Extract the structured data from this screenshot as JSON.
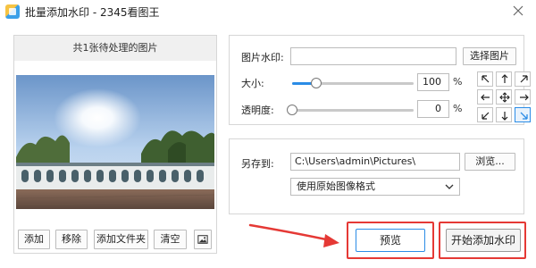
{
  "window": {
    "title": "批量添加水印 - 2345看图王"
  },
  "left_panel": {
    "header": "共1张待处理的图片",
    "buttons": {
      "add": "添加",
      "remove": "移除",
      "add_folder": "添加文件夹",
      "clear": "清空"
    }
  },
  "watermark": {
    "image_label": "图片水印:",
    "image_value": "",
    "choose_button": "选择图片",
    "size_label": "大小:",
    "size_value": "100",
    "size_unit": "%",
    "size_level": 0.2,
    "opacity_label": "透明度:",
    "opacity_value": "0",
    "opacity_unit": "%",
    "opacity_level": 0.0,
    "selected_position": "bottom-right"
  },
  "save": {
    "label": "另存到:",
    "path": "C:\\Users\\admin\\Pictures\\",
    "browse_button": "浏览...",
    "format": "使用原始图像格式"
  },
  "actions": {
    "preview": "预览",
    "start": "开始添加水印"
  },
  "colors": {
    "accent": "#2b8ce6",
    "highlight": "#e53935"
  }
}
